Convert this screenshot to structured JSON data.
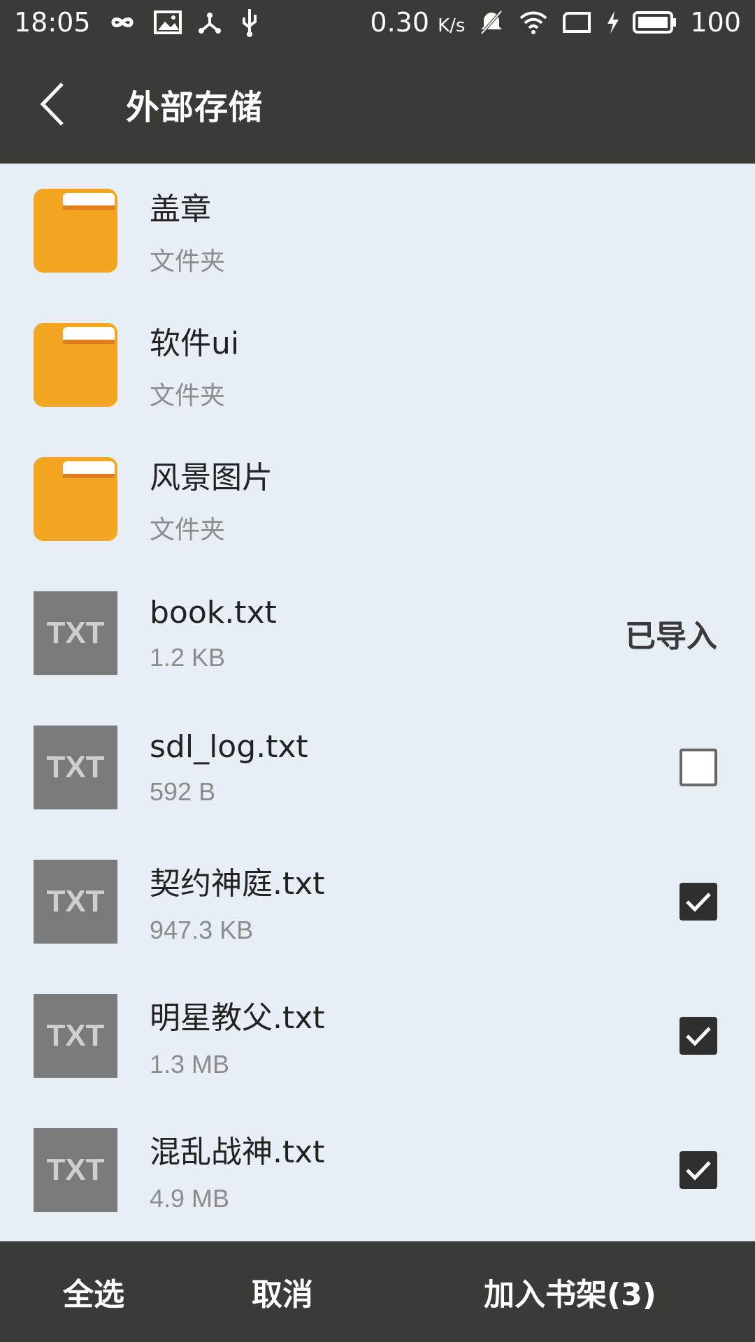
{
  "status_bar": {
    "time": "18:05",
    "speed": "0.30",
    "speed_unit": "K/s",
    "battery": "100",
    "icons": [
      "infinity-icon",
      "image-icon",
      "share-icon",
      "usb-icon",
      "mute-bell-icon",
      "wifi-icon",
      "tablet-icon",
      "charging-bolt-icon",
      "battery-icon"
    ]
  },
  "appbar": {
    "title": "外部存储"
  },
  "colors": {
    "bar": "#393b37",
    "background": "#e8eef5",
    "folder": "#f3a622",
    "txt_thumb": "#7a7a7a"
  },
  "items": [
    {
      "type": "folder",
      "name": "盖章",
      "sub": "文件夹"
    },
    {
      "type": "folder",
      "name": "软件ui",
      "sub": "文件夹"
    },
    {
      "type": "folder",
      "name": "风景图片",
      "sub": "文件夹"
    },
    {
      "type": "txt",
      "thumb": "TXT",
      "name": "book.txt",
      "sub": "1.2 KB",
      "state": "imported",
      "state_label": "已导入"
    },
    {
      "type": "txt",
      "thumb": "TXT",
      "name": "sdl_log.txt",
      "sub": "592 B",
      "state": "unchecked"
    },
    {
      "type": "txt",
      "thumb": "TXT",
      "name": "契约神庭.txt",
      "sub": "947.3 KB",
      "state": "checked"
    },
    {
      "type": "txt",
      "thumb": "TXT",
      "name": "明星教父.txt",
      "sub": "1.3 MB",
      "state": "checked"
    },
    {
      "type": "txt",
      "thumb": "TXT",
      "name": "混乱战神.txt",
      "sub": "4.9 MB",
      "state": "checked"
    }
  ],
  "bottom_bar": {
    "select_all": "全选",
    "cancel": "取消",
    "add_to_shelf": "加入书架(3)"
  }
}
